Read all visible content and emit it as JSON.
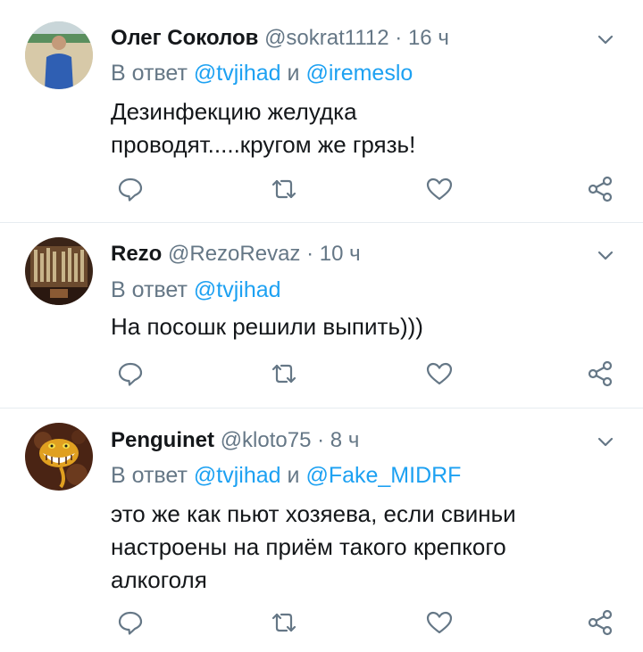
{
  "colors": {
    "name": "#14171a",
    "meta": "#657786",
    "mention": "#1da1f2",
    "icon": "#657786",
    "divider": "#e6ecf0"
  },
  "tweets": [
    {
      "name": "Олег Соколов",
      "handle": "@sokrat1112",
      "sep": "·",
      "time": "16 ч",
      "reply_prefix": "В ответ",
      "mention1": "@tvjihad",
      "conj": "и",
      "mention2": "@iremeslo",
      "text_lines": [
        "Дезинфекцию желудка",
        "проводят.....кругом же грязь!"
      ],
      "avatar_icon": "person-photo-icon"
    },
    {
      "name": "Rezo",
      "handle": "@RezoRevaz",
      "sep": "·",
      "time": "10 ч",
      "reply_prefix": "В ответ",
      "mention1": "@tvjihad",
      "text_lines": [
        "На посошк решили выпить)))"
      ],
      "avatar_icon": "organ-photo-icon"
    },
    {
      "name": "Penguinet",
      "handle": "@kloto75",
      "sep": "·",
      "time": "8 ч",
      "reply_prefix": "В ответ",
      "mention1": "@tvjihad",
      "conj": "и",
      "mention2": "@Fake_MIDRF",
      "text_lines": [
        "это же как пьют хозяева, если свиньи",
        "настроены на приём такого крепкого",
        "алкоголя"
      ],
      "avatar_icon": "cheshire-cat-icon"
    }
  ]
}
